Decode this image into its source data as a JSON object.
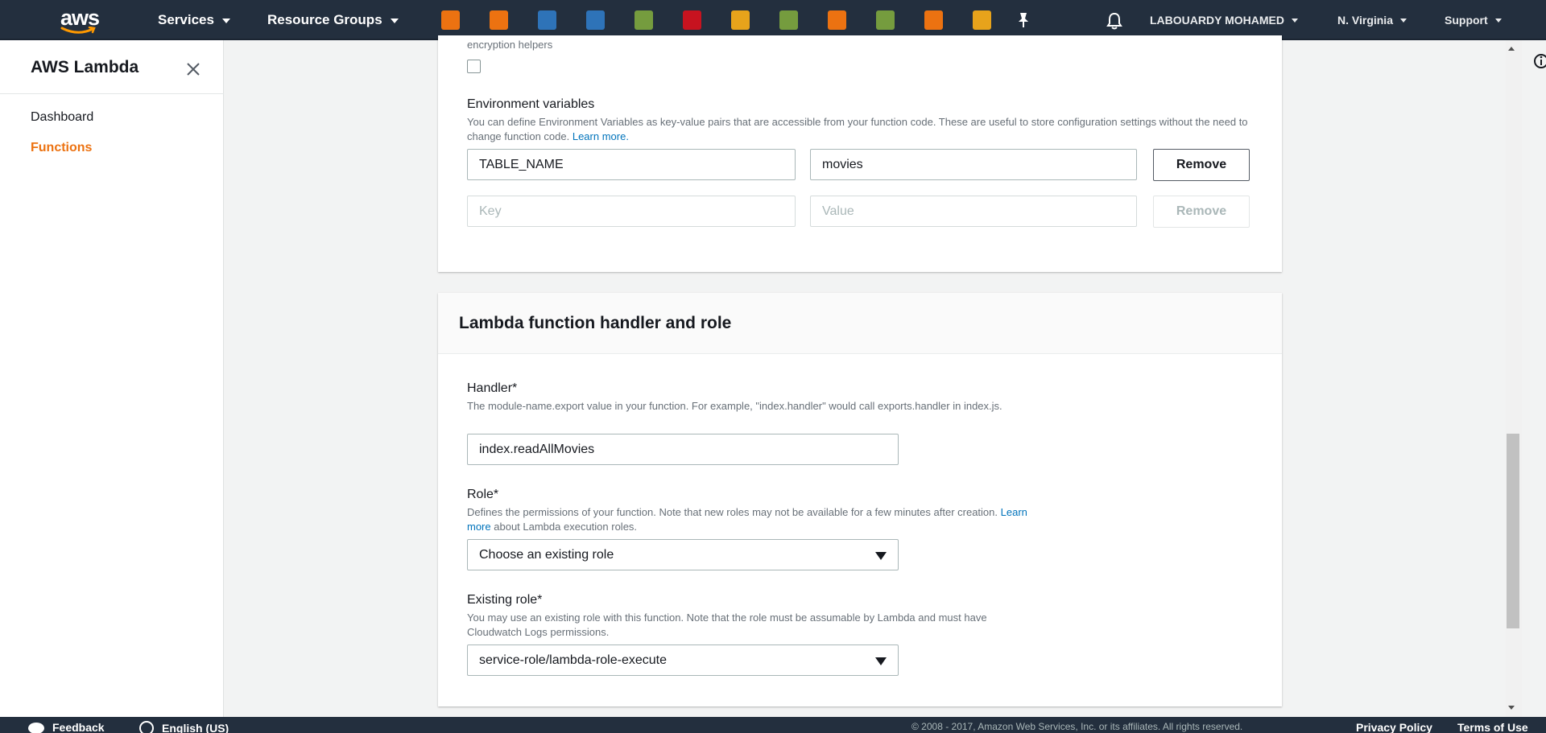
{
  "header": {
    "logo_text": "aws",
    "services_label": "Services",
    "resource_groups_label": "Resource Groups",
    "service_icons": [
      {
        "name": "ec2-icon",
        "color": "#ec7211"
      },
      {
        "name": "lambda-icon",
        "color": "#ec7211"
      },
      {
        "name": "s3-icon",
        "color": "#2e73b8"
      },
      {
        "name": "rds-icon",
        "color": "#2e73b8"
      },
      {
        "name": "cloudformation-icon",
        "color": "#759c3e"
      },
      {
        "name": "codedeploy-icon",
        "color": "#c7131f"
      },
      {
        "name": "storage-gateway-icon",
        "color": "#e7a31b"
      },
      {
        "name": "iam-icon",
        "color": "#759c3e"
      },
      {
        "name": "elastic-beanstalk-icon",
        "color": "#ec7211"
      },
      {
        "name": "cloudwatch-icon",
        "color": "#759c3e"
      },
      {
        "name": "ecs-icon",
        "color": "#ec7211"
      },
      {
        "name": "api-gateway-icon",
        "color": "#e7a31b"
      }
    ],
    "pin_icon": "pushpin-icon",
    "bell_icon": "bell-icon",
    "user_label": "LABOUARDY MOHAMED",
    "region_label": "N. Virginia",
    "support_label": "Support"
  },
  "sidebar": {
    "title": "AWS Lambda",
    "items": [
      {
        "label": "Dashboard",
        "active": false
      },
      {
        "label": "Functions",
        "active": true
      }
    ]
  },
  "encryption": {
    "helper_text": "encryption helpers"
  },
  "env_vars": {
    "label": "Environment variables",
    "help_text": "You can define Environment Variables as key-value pairs that are accessible from your function code. These are useful to store configuration settings without the need to change function code.",
    "learn_more": "Learn more.",
    "rows": [
      {
        "key": "TABLE_NAME",
        "value": "movies",
        "remove_label": "Remove"
      }
    ],
    "new_row": {
      "key_placeholder": "Key",
      "value_placeholder": "Value",
      "remove_label": "Remove"
    }
  },
  "handler_role": {
    "title": "Lambda function handler and role",
    "handler_label": "Handler*",
    "handler_help": "The module-name.export value in your function. For example, \"index.handler\" would call exports.handler in index.js.",
    "handler_value": "index.readAllMovies",
    "role_label": "Role*",
    "role_help_pre": "Defines the permissions of your function. Note that new roles may not be available for a few minutes after creation.",
    "role_learn_more": "Learn more",
    "role_help_post": "about Lambda execution roles.",
    "role_value": "Choose an existing role",
    "existing_role_label": "Existing role*",
    "existing_role_help": "You may use an existing role with this function. Note that the role must be assumable by Lambda and must have Cloudwatch Logs permissions.",
    "existing_role_value": "service-role/lambda-role-execute"
  },
  "footer": {
    "feedback_label": "Feedback",
    "language_label": "English (US)",
    "copyright": "© 2008 - 2017, Amazon Web Services, Inc. or its affiliates. All rights reserved.",
    "privacy_label": "Privacy Policy",
    "terms_label": "Terms of Use"
  }
}
